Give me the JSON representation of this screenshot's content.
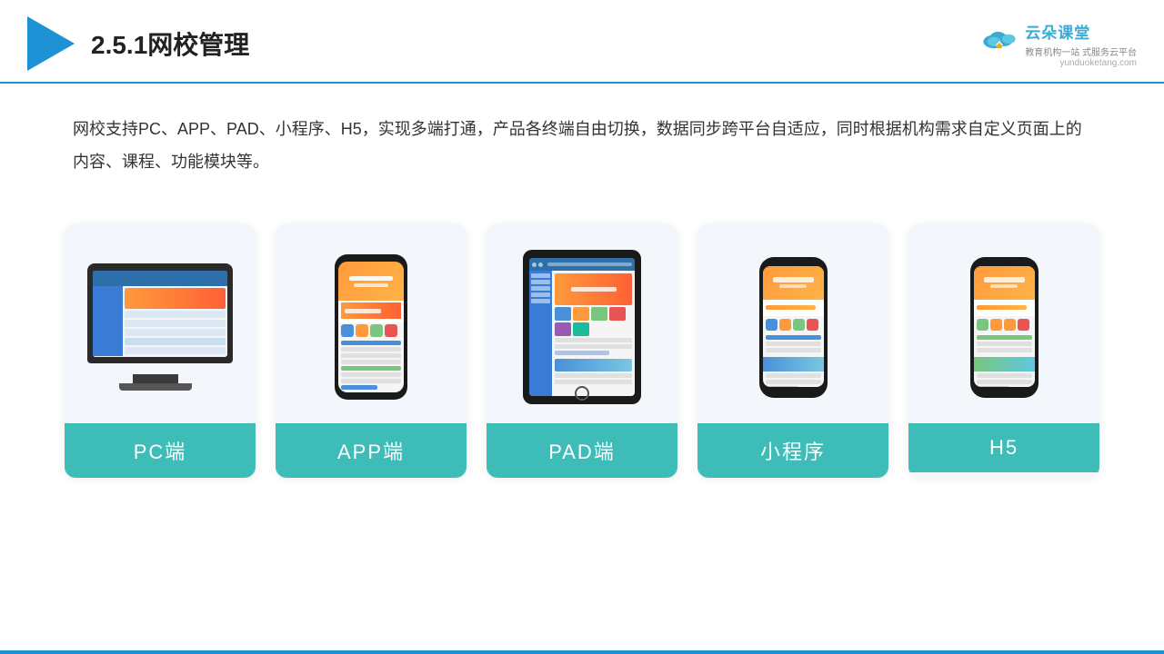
{
  "header": {
    "title": "2.5.1网校管理",
    "brand_main": "云朵课堂",
    "brand_url": "yunduoketang.com",
    "brand_slogan": "教育机构一站\n式服务云平台"
  },
  "description": "网校支持PC、APP、PAD、小程序、H5，实现多端打通，产品各终端自由切换，数据同步跨平台自适应，同时根据机构需求自定义页面上的内容、课程、功能模块等。",
  "cards": [
    {
      "id": "pc",
      "label": "PC端"
    },
    {
      "id": "app",
      "label": "APP端"
    },
    {
      "id": "pad",
      "label": "PAD端"
    },
    {
      "id": "miniprogram",
      "label": "小程序"
    },
    {
      "id": "h5",
      "label": "H5"
    }
  ]
}
